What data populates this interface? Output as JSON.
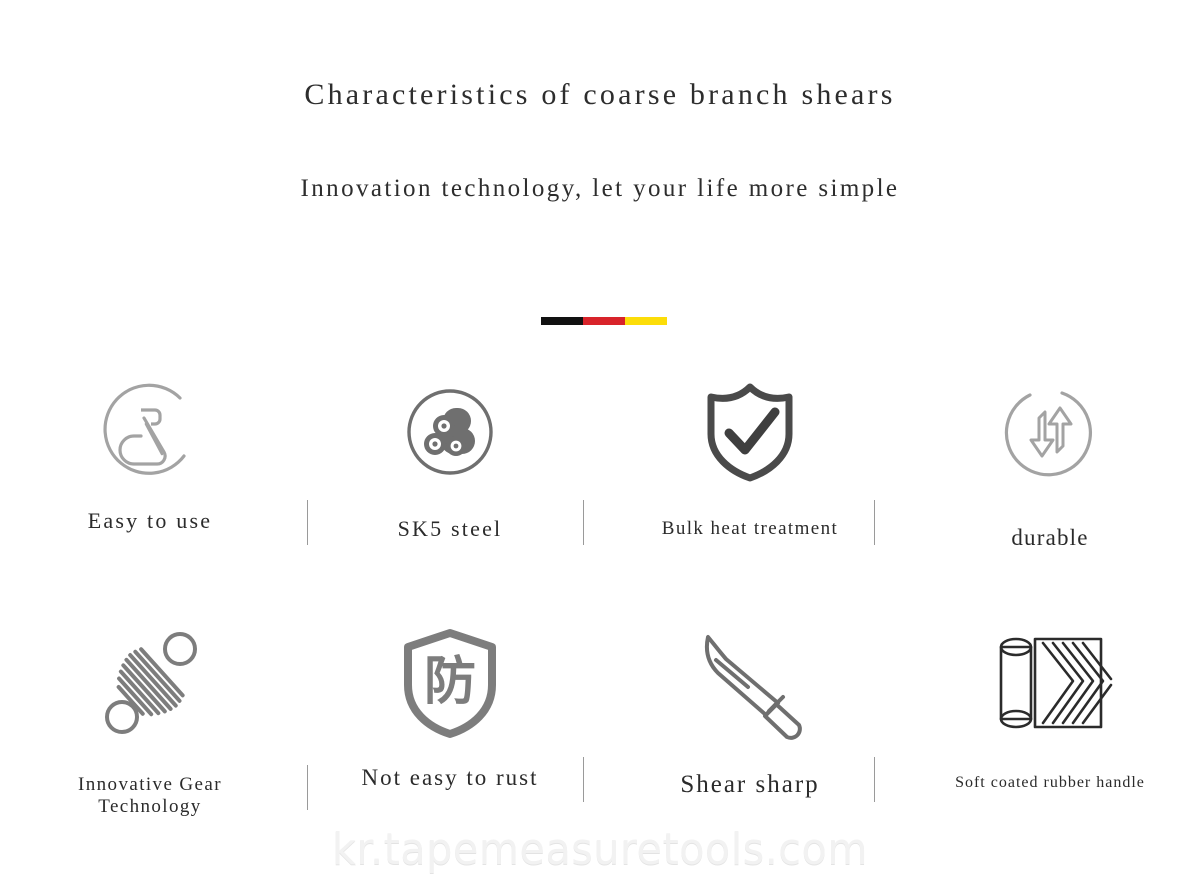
{
  "heading": {
    "title": "Characteristics of coarse branch shears",
    "subtitle": "Innovation technology, let your life more simple"
  },
  "divider": {
    "name": "tricolor-bar",
    "segments": [
      "#111111",
      "#d8232a",
      "#fcdd09"
    ]
  },
  "features": {
    "row1": [
      {
        "icon": "easy-grip-circle-icon",
        "label": "Easy to use"
      },
      {
        "icon": "steel-coils-circle-icon",
        "label": "SK5 steel"
      },
      {
        "icon": "shield-check-icon",
        "label": "Bulk heat treatment"
      },
      {
        "icon": "durable-arrows-circle-icon",
        "label": "durable"
      }
    ],
    "row2": [
      {
        "icon": "spring-gear-icon",
        "label": "Innovative Gear\nTechnology"
      },
      {
        "icon": "anti-rust-shield-icon",
        "label": "Not easy to rust"
      },
      {
        "icon": "knife-blade-icon",
        "label": "Shear sharp"
      },
      {
        "icon": "rubber-grip-icon",
        "label": "Soft coated rubber handle"
      }
    ]
  },
  "anti_rust_glyph": "防",
  "watermark": "kr.tapemeasuretools.com",
  "colors": {
    "background": "#ffffff",
    "text": "#2b2b2b",
    "icon_light": "#9a9a9a",
    "icon_mid": "#7d7d7d",
    "icon_dark": "#4a4a4a",
    "separator": "#9a9a9a",
    "watermark": "#f2f2f2"
  }
}
